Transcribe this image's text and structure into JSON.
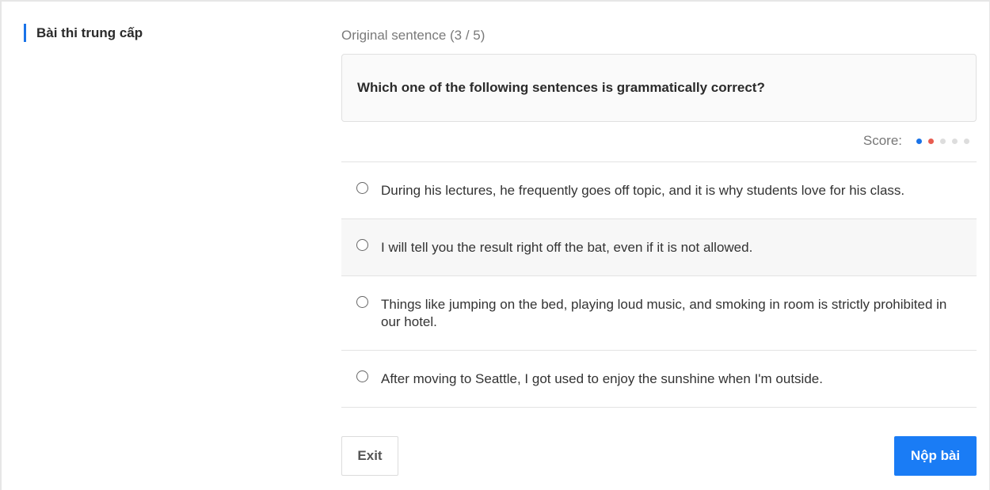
{
  "sidebar": {
    "title": "Bài thi trung cấp"
  },
  "question": {
    "progress_label": "Original sentence (3 / 5)",
    "prompt": "Which one of the following sentences is grammatically correct?"
  },
  "score": {
    "label": "Score:",
    "dots": [
      "#1a73e8",
      "#e85c50",
      "#dddddd",
      "#dddddd",
      "#dddddd"
    ]
  },
  "options": [
    {
      "text": "During his lectures, he frequently goes off topic, and it is why students love for his class."
    },
    {
      "text": "I will tell you the result right off the bat, even if it is not allowed."
    },
    {
      "text": "Things like jumping on the bed, playing loud music, and smoking in room is strictly prohibited in our hotel."
    },
    {
      "text": "After moving to Seattle, I got used to enjoy the sunshine when I'm outside."
    }
  ],
  "actions": {
    "exit_label": "Exit",
    "submit_label": "Nộp bài"
  },
  "colors": {
    "accent": "#1a7cf5",
    "correct": "#1a73e8",
    "wrong": "#e85c50",
    "pending": "#dddddd"
  },
  "icons": {
    "option_marker": "radio-unchecked-icon"
  }
}
